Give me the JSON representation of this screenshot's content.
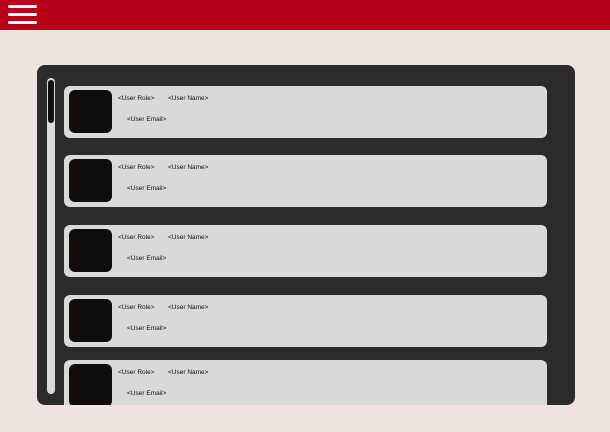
{
  "header": {
    "menu_icon": "hamburger-menu-icon",
    "bar_color": "#b3001b"
  },
  "users": [
    {
      "role": "<User Role>",
      "name": "<User Name>",
      "email": "<User Email>"
    },
    {
      "role": "<User Role>",
      "name": "<User Name>",
      "email": "<User Email>"
    },
    {
      "role": "<User Role>",
      "name": "<User Name>",
      "email": "<User Email>"
    },
    {
      "role": "<User Role>",
      "name": "<User Name>",
      "email": "<User Email>"
    },
    {
      "role": "<User Role>",
      "name": "<User Name>",
      "email": "<User Email>"
    }
  ]
}
